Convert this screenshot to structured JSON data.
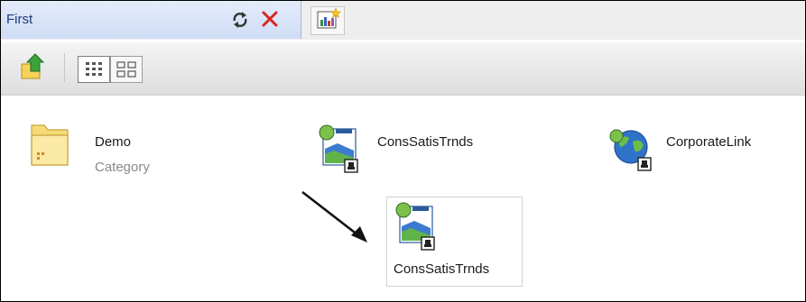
{
  "tab": {
    "title": "First",
    "refresh_icon": "refresh-icon",
    "close_icon": "close-icon",
    "new_tab_icon": "new-dashboard-tab-icon"
  },
  "toolbar": {
    "up_icon": "up-folder-icon",
    "views": [
      {
        "icon": "icon-view-grid-icon",
        "active": true
      },
      {
        "icon": "detail-view-icon",
        "active": false
      }
    ]
  },
  "items": [
    {
      "name": "Demo",
      "subtitle": "Category",
      "icon": "folder-icon"
    },
    {
      "name": "ConsSatisTrnds",
      "icon": "report-chart-icon"
    },
    {
      "name": "CorporateLink",
      "icon": "web-link-icon"
    }
  ],
  "dragged_item": {
    "name": "ConsSatisTrnds",
    "icon": "report-chart-icon"
  },
  "colors": {
    "tab_text": "#1b3b79",
    "close_red": "#d8261d",
    "category_gray": "#8a8a8a"
  }
}
